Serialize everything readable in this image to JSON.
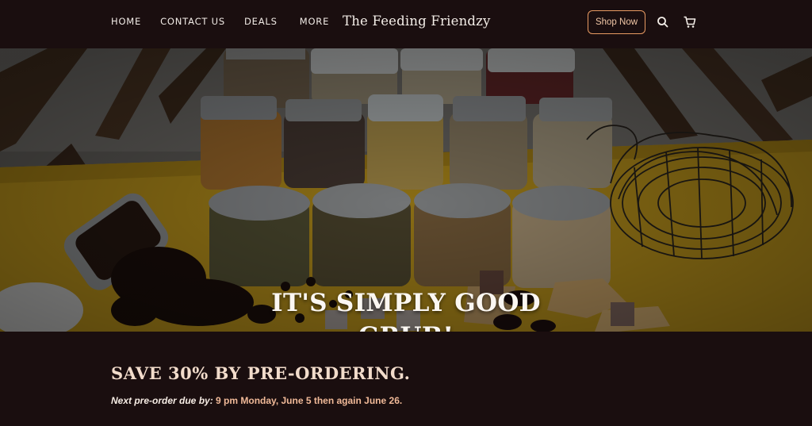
{
  "nav": {
    "items": [
      {
        "label": "HOME"
      },
      {
        "label": "CONTACT US"
      },
      {
        "label": "DEALS"
      },
      {
        "label": "MORE"
      }
    ]
  },
  "brand": {
    "name": "The Feeding Friendzy"
  },
  "header": {
    "shop_label": "Shop Now",
    "search_icon": "search-icon",
    "cart_icon": "cart-icon"
  },
  "hero": {
    "line1": "IT'S SIMPLY GOOD",
    "line2": "GRUB!"
  },
  "promo": {
    "title": "SAVE 30% BY PRE-ORDERING.",
    "label": "Next pre-order due by:",
    "when": " 9 pm Monday, June 5 then again June 26."
  },
  "colors": {
    "background": "#1a0e0f",
    "accent": "#e89a62",
    "table": "#e0b21c"
  }
}
